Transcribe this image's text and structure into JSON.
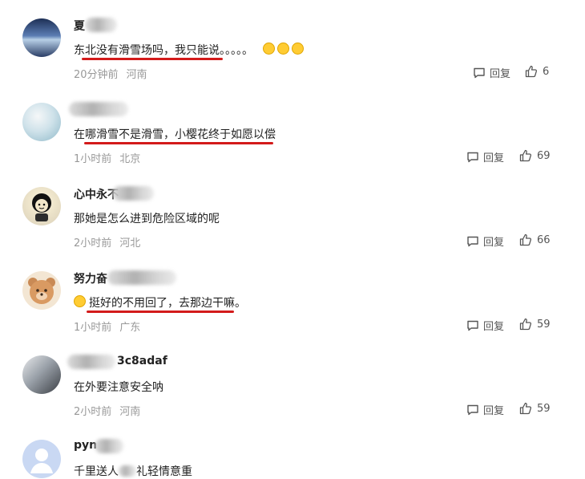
{
  "comments": [
    {
      "name": "夏",
      "text": "东北没有滑雪场吗，我只能说。。。。。",
      "emoji_count": 3,
      "time": "20分钟前",
      "location": "河南",
      "reply_label": "回复",
      "likes": "6"
    },
    {
      "name": "",
      "text": "在哪滑雪不是滑雪，小樱花终于如愿以偿",
      "time": "1小时前",
      "location": "北京",
      "reply_label": "回复",
      "likes": "69"
    },
    {
      "name": "心中永不",
      "text": "那她是怎么进到危险区域的呢",
      "time": "2小时前",
      "location": "河北",
      "reply_label": "回复",
      "likes": "66"
    },
    {
      "name": "努力奋",
      "text": "挺好的不用回了，去那边干嘛。",
      "time": "1小时前",
      "location": "广东",
      "reply_label": "回复",
      "likes": "59"
    },
    {
      "name": "3c8adaf",
      "text": "在外要注意安全呐",
      "time": "2小时前",
      "location": "河南",
      "reply_label": "回复",
      "likes": "59"
    },
    {
      "name": "pyn",
      "text": "千里送人",
      "text_tail": "礼轻情意重"
    }
  ],
  "colors": {
    "underline": "#d31b1b",
    "meta": "#999999",
    "emoji": "#ffcc33"
  },
  "icons": {
    "reply": "comment-bubble-icon",
    "like": "thumbs-up-icon"
  }
}
